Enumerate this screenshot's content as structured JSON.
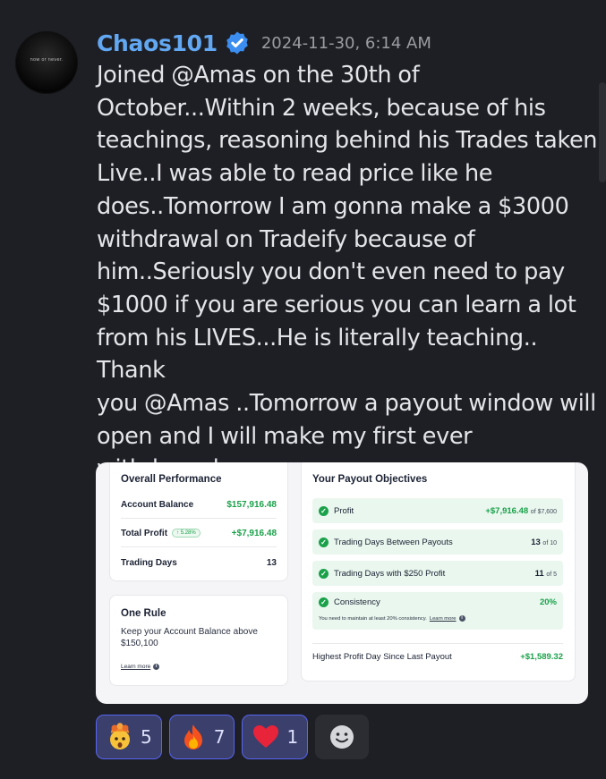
{
  "post": {
    "avatar_text": "now or never.",
    "username": "Chaos101",
    "timestamp": "2024-11-30, 6:14 AM",
    "text": "Joined @Amas on the 30th of\nOctober...Within 2 weeks, because of his\nteachings, reasoning behind his Trades taken\nLive..I was able to read price like he\ndoes..Tomorrow I am gonna make a $3000\nwithdrawal on Tradeify because of\nhim..Seriously you don't even need to pay\n$1000 if you are serious you can learn a lot\nfrom his LIVES...He is literally teaching.. Thank\nyou @Amas ..Tomorrow a payout window will\nopen and I will make my first ever withdrawal\nwith a prop firm.."
  },
  "attachment": {
    "overall": {
      "title": "Overall Performance",
      "account_balance_label": "Account Balance",
      "account_balance_value": "$157,916.48",
      "total_profit_label": "Total Profit",
      "total_profit_badge": "↑ 5.28%",
      "total_profit_value": "+$7,916.48",
      "trading_days_label": "Trading Days",
      "trading_days_value": "13"
    },
    "one_rule": {
      "title": "One Rule",
      "text": "Keep your Account Balance above $150,100",
      "learn_more": "Learn more"
    },
    "payout": {
      "title": "Your Payout Objectives",
      "profit_label": "Profit",
      "profit_value": "+$7,916.48",
      "profit_of": "of $7,600",
      "days_between_label": "Trading Days Between Payouts",
      "days_between_value": "13",
      "days_between_of": "of 10",
      "days_250_label": "Trading Days with $250 Profit",
      "days_250_value": "11",
      "days_250_of": "of 5",
      "consistency_label": "Consistency",
      "consistency_value": "20%",
      "consistency_note": "You need to maintain at least 20% consistency.",
      "consistency_learn": "Learn more",
      "highest_label": "Highest Profit Day Since Last Payout",
      "highest_value": "+$1,589.32"
    }
  },
  "reactions": [
    {
      "icon": "exploding-head-emoji",
      "count": "5"
    },
    {
      "icon": "fire-emoji",
      "count": "7"
    },
    {
      "icon": "heart-emoji",
      "count": "1"
    }
  ],
  "colors": {
    "background": "#1e1f24",
    "username": "#62a7f2",
    "profit_green": "#1aa14a",
    "reaction_border": "#5865f2"
  }
}
